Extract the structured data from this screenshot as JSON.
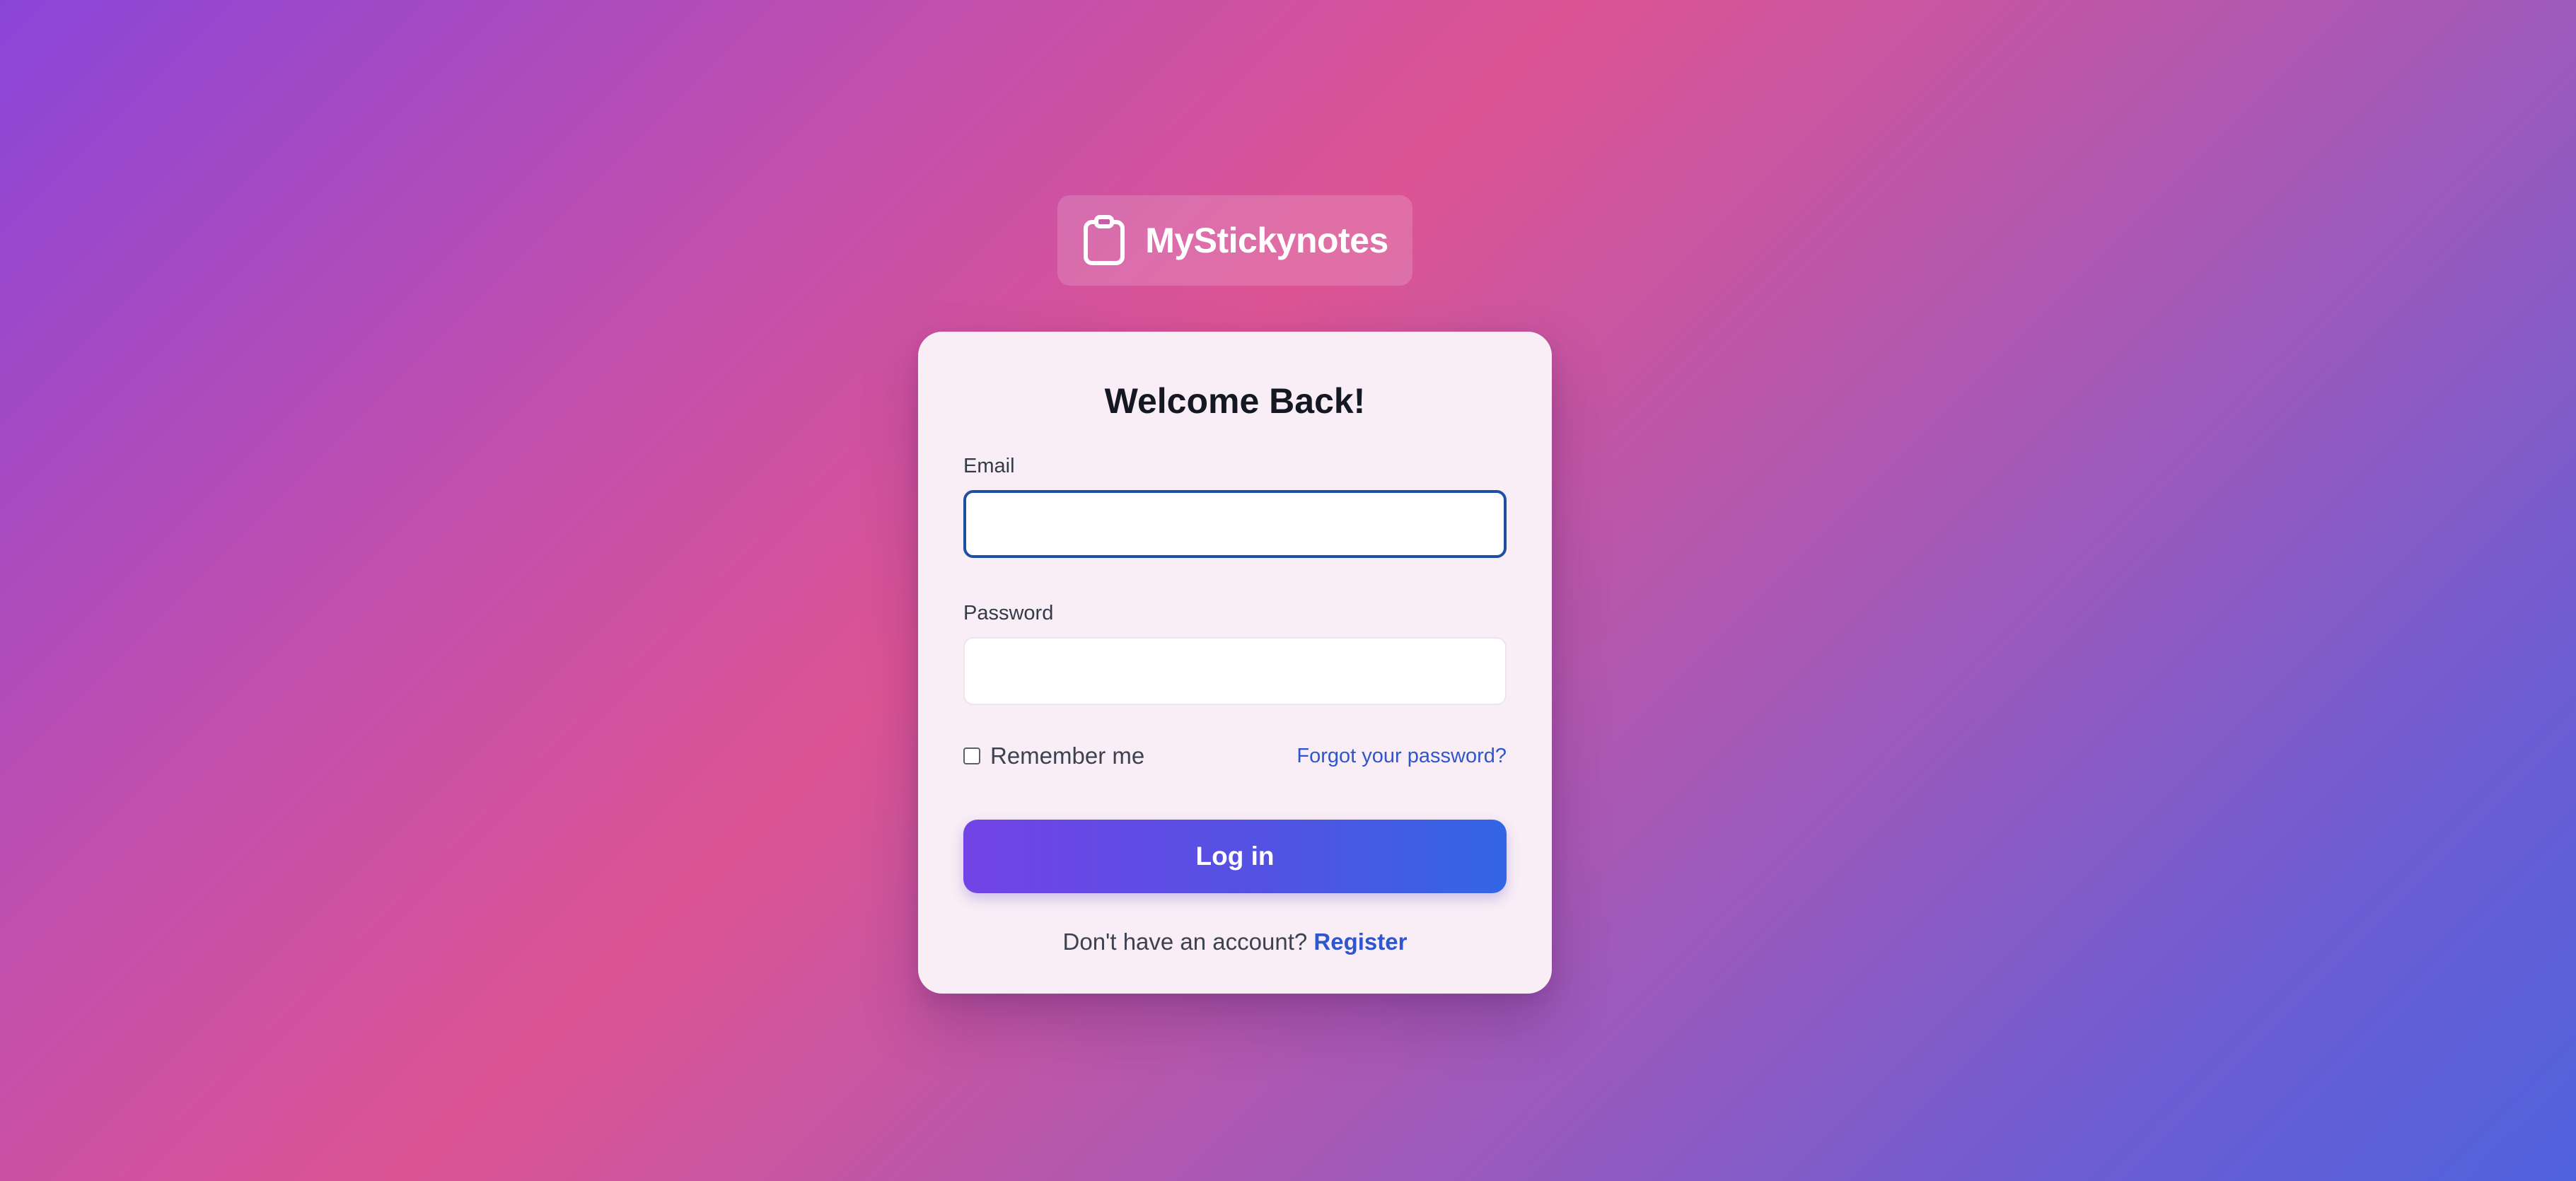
{
  "brand": {
    "name": "MyStickynotes",
    "icon": "clipboard-icon"
  },
  "login_form": {
    "title": "Welcome Back!",
    "email_label": "Email",
    "email_value": "",
    "password_label": "Password",
    "password_value": "",
    "remember_label": "Remember me",
    "remember_checked": false,
    "forgot_link": "Forgot your password?",
    "submit_label": "Log in",
    "no_account_text": "Don't have an account?",
    "register_link": "Register"
  },
  "colors": {
    "accent_link": "#2f55cf",
    "button_start": "#7343e6",
    "button_end": "#3366e4",
    "focus_ring": "#1d4fa3"
  }
}
